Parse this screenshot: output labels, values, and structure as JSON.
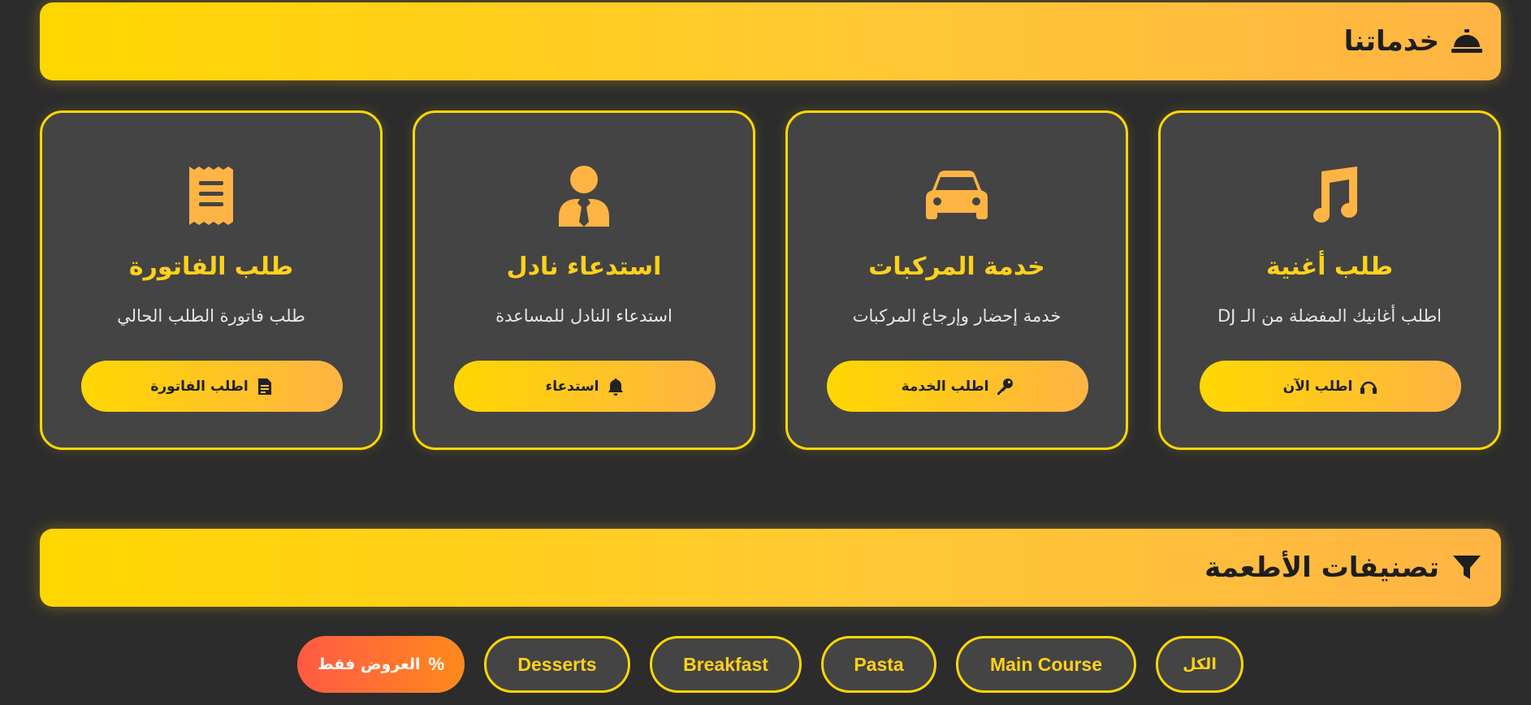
{
  "services": {
    "header": {
      "title": "خدماتنا",
      "icon": "concierge-bell-icon"
    },
    "cards": [
      {
        "icon": "music-icon",
        "title": "طلب أغنية",
        "desc": "اطلب أغانيك المفضلة من الـ DJ",
        "button": "اطلب الآن",
        "button_icon": "headphones-icon"
      },
      {
        "icon": "car-icon",
        "title": "خدمة المركبات",
        "desc": "خدمة إحضار وإرجاع المركبات",
        "button": "اطلب الخدمة",
        "button_icon": "key-icon"
      },
      {
        "icon": "waiter-icon",
        "title": "استدعاء نادل",
        "desc": "استدعاء النادل للمساعدة",
        "button": "استدعاء",
        "button_icon": "bell-icon"
      },
      {
        "icon": "receipt-icon",
        "title": "طلب الفاتورة",
        "desc": "طلب فاتورة الطلب الحالي",
        "button": "اطلب الفاتورة",
        "button_icon": "invoice-icon"
      }
    ]
  },
  "categories": {
    "header": {
      "title": "تصنيفات الأطعمة",
      "icon": "filter-icon"
    },
    "filters": [
      {
        "label": "الكل",
        "active": false
      },
      {
        "label": "Main Course",
        "active": false
      },
      {
        "label": "Pasta",
        "active": false
      },
      {
        "label": "Breakfast",
        "active": false
      },
      {
        "label": "Desserts",
        "active": false
      },
      {
        "label": "العروض فقط",
        "icon": "percent-icon",
        "icon_glyph": "%",
        "active": true
      }
    ]
  },
  "colors": {
    "accent": "#ffd700",
    "accent_end": "#ffb444",
    "card_bg": "#444444",
    "page_bg": "#2c2c2c",
    "offer_start": "#ff5a45",
    "offer_end": "#ff8a1c"
  }
}
